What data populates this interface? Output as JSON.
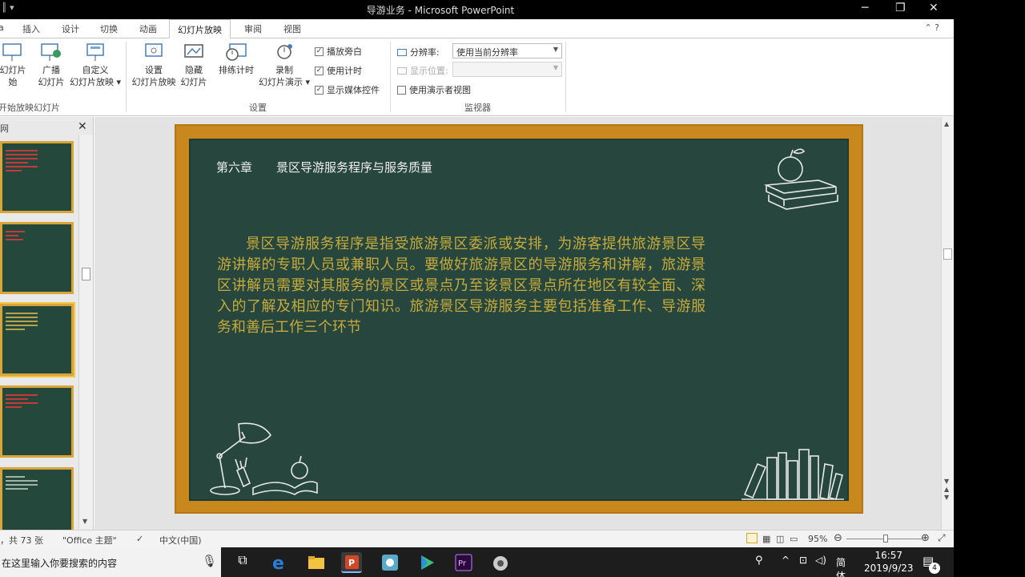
{
  "window": {
    "title": "导游业务 - Microsoft PowerPoint",
    "minimize": "─",
    "restore": "❐",
    "close": "✕"
  },
  "tabs": [
    {
      "label": "插入"
    },
    {
      "label": "设计"
    },
    {
      "label": "切换"
    },
    {
      "label": "动画"
    },
    {
      "label": "幻灯片放映",
      "active": true
    },
    {
      "label": "审阅"
    },
    {
      "label": "视图"
    }
  ],
  "ribbon": {
    "start_group": {
      "from_start_l1": "幻灯片",
      "from_start_l2": "始",
      "broadcast_l1": "广播",
      "broadcast_l2": "幻灯片",
      "custom_l1": "自定义",
      "custom_l2": "幻灯片放映 ▾",
      "label": "开始放映幻灯片"
    },
    "setup_group": {
      "setup_l1": "设置",
      "setup_l2": "幻灯片放映",
      "hide_l1": "隐藏",
      "hide_l2": "幻灯片",
      "rehearse": "排练计时",
      "record_l1": "录制",
      "record_l2": "幻灯片演示 ▾",
      "play_narration": "播放旁白",
      "use_timings": "使用计时",
      "show_media_controls": "显示媒体控件",
      "label": "设置"
    },
    "monitors_group": {
      "resolution_label": "分辨率:",
      "resolution_value": "使用当前分辨率",
      "show_on_label": "显示位置:",
      "show_on_value": "",
      "presenter_view": "使用演示者视图",
      "label": "监视器"
    }
  },
  "left_panel": {
    "tab_label": "网",
    "close": "✕"
  },
  "slide": {
    "chapter": "第六章　　景区导游服务程序与服务质量",
    "body": "景区导游服务程序是指受旅游景区委派或安排，为游客提供旅游景区导游讲解的专职人员或兼职人员。要做好旅游景区的导游服务和讲解，旅游景区讲解员需要对其服务的景区或景点乃至该景区景点所在地区有较全面、深入的了解及相应的专门知识。旅游景区导游服务主要包括准备工作、导游服务和善后工作三个环节"
  },
  "status_bar": {
    "slide_count": "，共 73 张",
    "theme": "\"Office 主题\"",
    "language": "中文(中国)",
    "zoom": "95%",
    "zoom_level_fraction": 0.52
  },
  "taskbar": {
    "search_placeholder": "在这里输入你要搜索的内容",
    "ime": "简体",
    "time": "16:57",
    "date": "2019/9/23",
    "notifications": "4"
  },
  "colors": {
    "board": "#27463d",
    "frame": "#c9881e",
    "body_text": "#c6ab3c",
    "chapter_text": "#f0f0f0"
  }
}
